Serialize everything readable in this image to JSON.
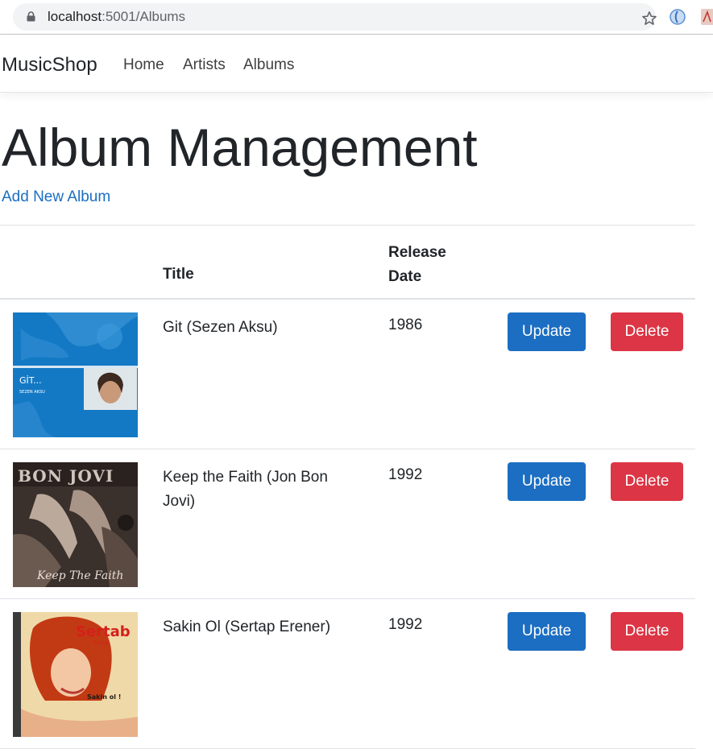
{
  "browser": {
    "url_host": "localhost",
    "url_path": ":5001/Albums"
  },
  "navbar": {
    "brand": "MusicShop",
    "links": [
      "Home",
      "Artists",
      "Albums"
    ]
  },
  "page": {
    "title": "Album Management",
    "add_link": "Add New Album"
  },
  "table": {
    "headers": {
      "cover": "",
      "title": "Title",
      "release_date": "Release Date",
      "actions": ""
    },
    "rows": [
      {
        "title": "Git (Sezen Aksu)",
        "release_date": "1986",
        "update_label": "Update",
        "delete_label": "Delete"
      },
      {
        "title": "Keep the Faith (Jon Bon Jovi)",
        "release_date": "1992",
        "update_label": "Update",
        "delete_label": "Delete"
      },
      {
        "title": "Sakin Ol (Sertap Erener)",
        "release_date": "1992",
        "update_label": "Update",
        "delete_label": "Delete"
      }
    ]
  },
  "colors": {
    "primary": "#1b6ec2",
    "danger": "#dc3545",
    "border": "#dee2e6"
  }
}
